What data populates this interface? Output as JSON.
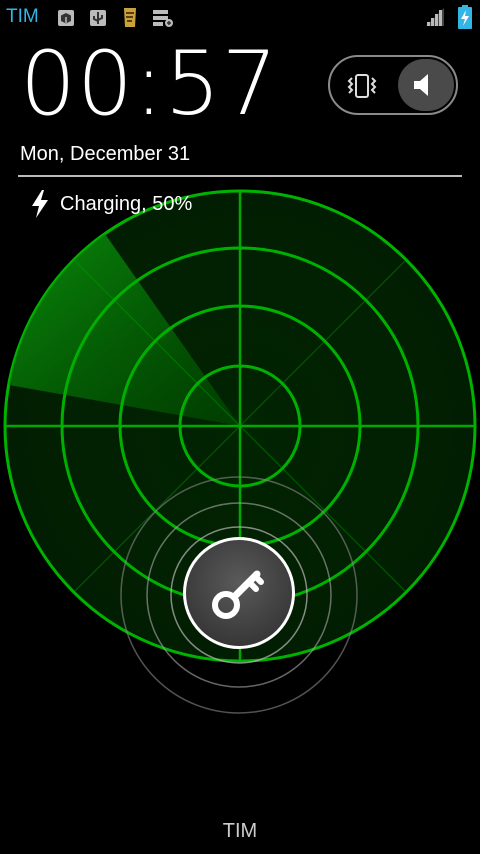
{
  "status_bar": {
    "carrier": "TIM",
    "icons": [
      "cube-icon",
      "usb-icon",
      "apk-icon",
      "storage-icon"
    ],
    "signal": "signal-bars-icon",
    "battery": "battery-charging-icon"
  },
  "clock": {
    "time": "00:57"
  },
  "date": "Mon, December 31",
  "sound_toggle": {
    "options": [
      "vibrate",
      "sound"
    ],
    "selected": "sound"
  },
  "charging": {
    "text": "Charging, 50%",
    "icon": "lightning-icon"
  },
  "radar": {
    "color": "#00b000",
    "sweep_color": "#00a000"
  },
  "unlock": {
    "icon": "key-icon"
  },
  "carrier_bottom": "TIM"
}
